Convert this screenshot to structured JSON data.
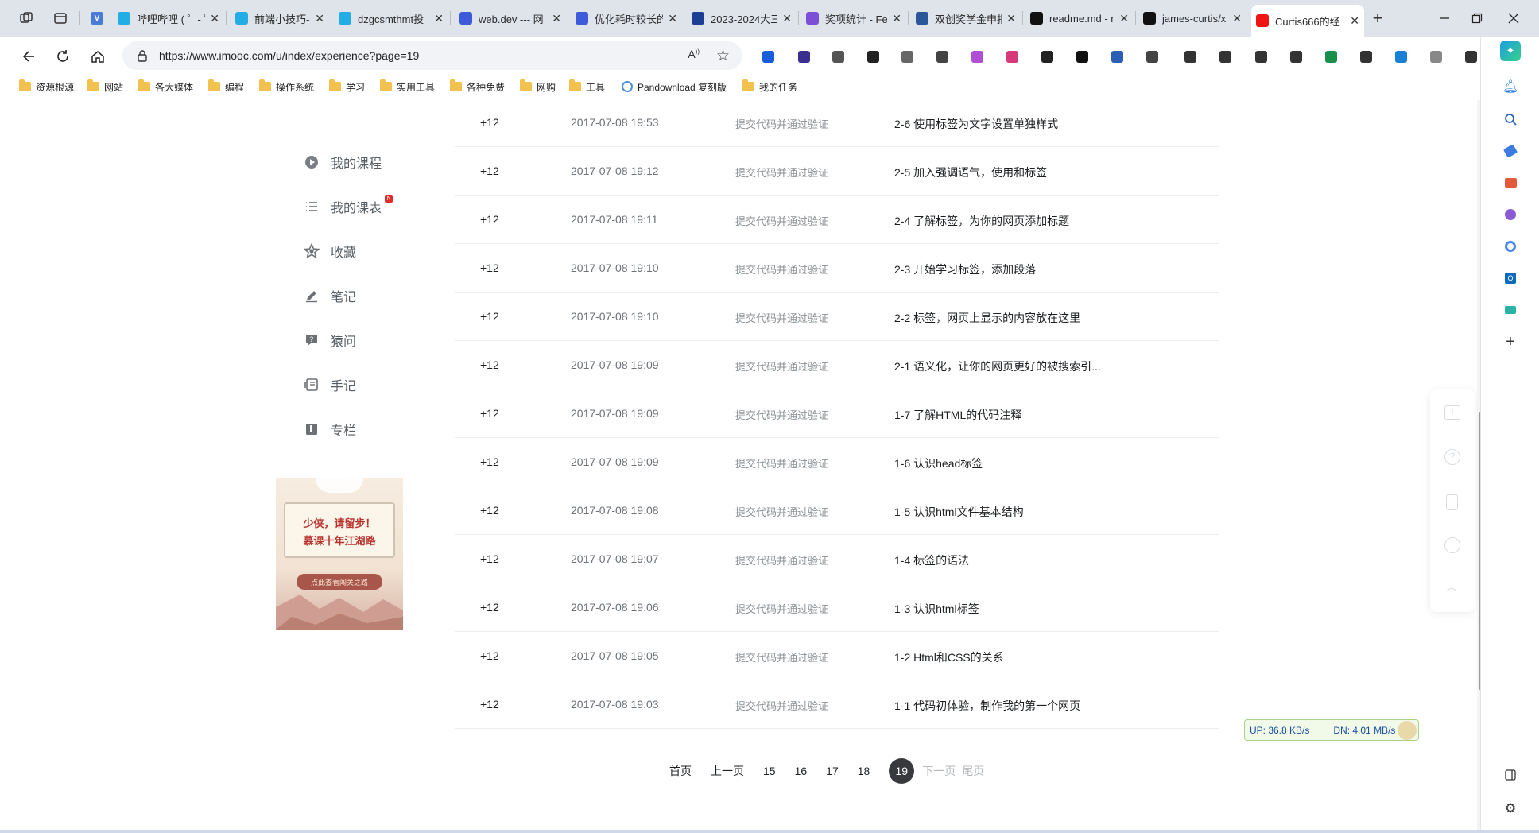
{
  "browser": {
    "tabs": [
      {
        "title": "哔哩哔哩 ( ゜- ゜",
        "favicon": "bilibili-icon",
        "color": "#23ade5"
      },
      {
        "title": "前端小技巧-知",
        "favicon": "bilibili-icon",
        "color": "#23ade5"
      },
      {
        "title": "dzgcsmthmt投",
        "favicon": "bilibili-icon",
        "color": "#23ade5"
      },
      {
        "title": "web.dev --- 网",
        "favicon": "terminal-icon",
        "color": "#3b5bdb"
      },
      {
        "title": "优化耗时较长的",
        "favicon": "terminal-icon",
        "color": "#3b5bdb"
      },
      {
        "title": "2023-2024大三",
        "favicon": "sync-icon",
        "color": "#1c3f95"
      },
      {
        "title": "奖项统计 - Fei",
        "favicon": "feishu-icon",
        "color": "#7b4fd6"
      },
      {
        "title": "双创奖学金申报",
        "favicon": "word-icon",
        "color": "#2b579a"
      },
      {
        "title": "readme.md - n",
        "favicon": "github-icon",
        "color": "#111111"
      },
      {
        "title": "james-curtis/x",
        "favicon": "github-icon",
        "color": "#111111"
      },
      {
        "title": "Curtis666的经",
        "favicon": "imooc-icon",
        "color": "#f01414"
      }
    ],
    "url": "https://www.imooc.com/u/index/experience?page=19",
    "bookmarks": [
      "资源根源",
      "网站",
      "各大媒体",
      "编程",
      "操作系统",
      "学习",
      "实用工具",
      "各种免费",
      "网购",
      "工具",
      "Pandownload 复刻版",
      "我的任务"
    ]
  },
  "sidebar": {
    "items": [
      {
        "label": "我的课程",
        "icon": "play-circle-icon"
      },
      {
        "label": "我的课表",
        "icon": "list-icon",
        "badge": "N"
      },
      {
        "label": "收藏",
        "icon": "star-icon"
      },
      {
        "label": "笔记",
        "icon": "pencil-icon"
      },
      {
        "label": "猿问",
        "icon": "question-icon"
      },
      {
        "label": "手记",
        "icon": "notebook-icon"
      },
      {
        "label": "专栏",
        "icon": "bookmark-icon"
      }
    ],
    "banner": {
      "line1": "少侠，请留步！",
      "line2": "慕课十年江湖路",
      "button": "点此查看闯关之路"
    }
  },
  "experience": {
    "rows": [
      {
        "points": "+12",
        "time": "2017-07-08 19:53",
        "action": "提交代码并通过验证",
        "lesson": "2-6 使用标签为文字设置单独样式"
      },
      {
        "points": "+12",
        "time": "2017-07-08 19:12",
        "action": "提交代码并通过验证",
        "lesson": "2-5 加入强调语气，使用和标签"
      },
      {
        "points": "+12",
        "time": "2017-07-08 19:11",
        "action": "提交代码并通过验证",
        "lesson": "2-4 了解标签，为你的网页添加标题"
      },
      {
        "points": "+12",
        "time": "2017-07-08 19:10",
        "action": "提交代码并通过验证",
        "lesson": "2-3 开始学习标签，添加段落"
      },
      {
        "points": "+12",
        "time": "2017-07-08 19:10",
        "action": "提交代码并通过验证",
        "lesson": "2-2 标签，网页上显示的内容放在这里"
      },
      {
        "points": "+12",
        "time": "2017-07-08 19:09",
        "action": "提交代码并通过验证",
        "lesson": "2-1 语义化，让你的网页更好的被搜索引..."
      },
      {
        "points": "+12",
        "time": "2017-07-08 19:09",
        "action": "提交代码并通过验证",
        "lesson": "1-7 了解HTML的代码注释"
      },
      {
        "points": "+12",
        "time": "2017-07-08 19:09",
        "action": "提交代码并通过验证",
        "lesson": "1-6 认识head标签"
      },
      {
        "points": "+12",
        "time": "2017-07-08 19:08",
        "action": "提交代码并通过验证",
        "lesson": "1-5 认识html文件基本结构"
      },
      {
        "points": "+12",
        "time": "2017-07-08 19:07",
        "action": "提交代码并通过验证",
        "lesson": "1-4 标签的语法"
      },
      {
        "points": "+12",
        "time": "2017-07-08 19:06",
        "action": "提交代码并通过验证",
        "lesson": "1-3 认识html标签"
      },
      {
        "points": "+12",
        "time": "2017-07-08 19:05",
        "action": "提交代码并通过验证",
        "lesson": "1-2 Html和CSS的关系"
      },
      {
        "points": "+12",
        "time": "2017-07-08 19:03",
        "action": "提交代码并通过验证",
        "lesson": "1-1 代码初体验，制作我的第一个网页"
      }
    ]
  },
  "pagination": {
    "first": "首页",
    "prev": "上一页",
    "pages": [
      "15",
      "16",
      "17",
      "18"
    ],
    "current": "19",
    "next": "下一页",
    "last": "尾页"
  },
  "netspeed": {
    "up": "UP: 36.8 KB/s",
    "down": "DN: 4.01 MB/s"
  },
  "colors": {
    "accent": "#37393d",
    "muted": "#b5b9bc",
    "tab_active": "#ffffff",
    "browser_chrome": "#dfe3ea"
  }
}
